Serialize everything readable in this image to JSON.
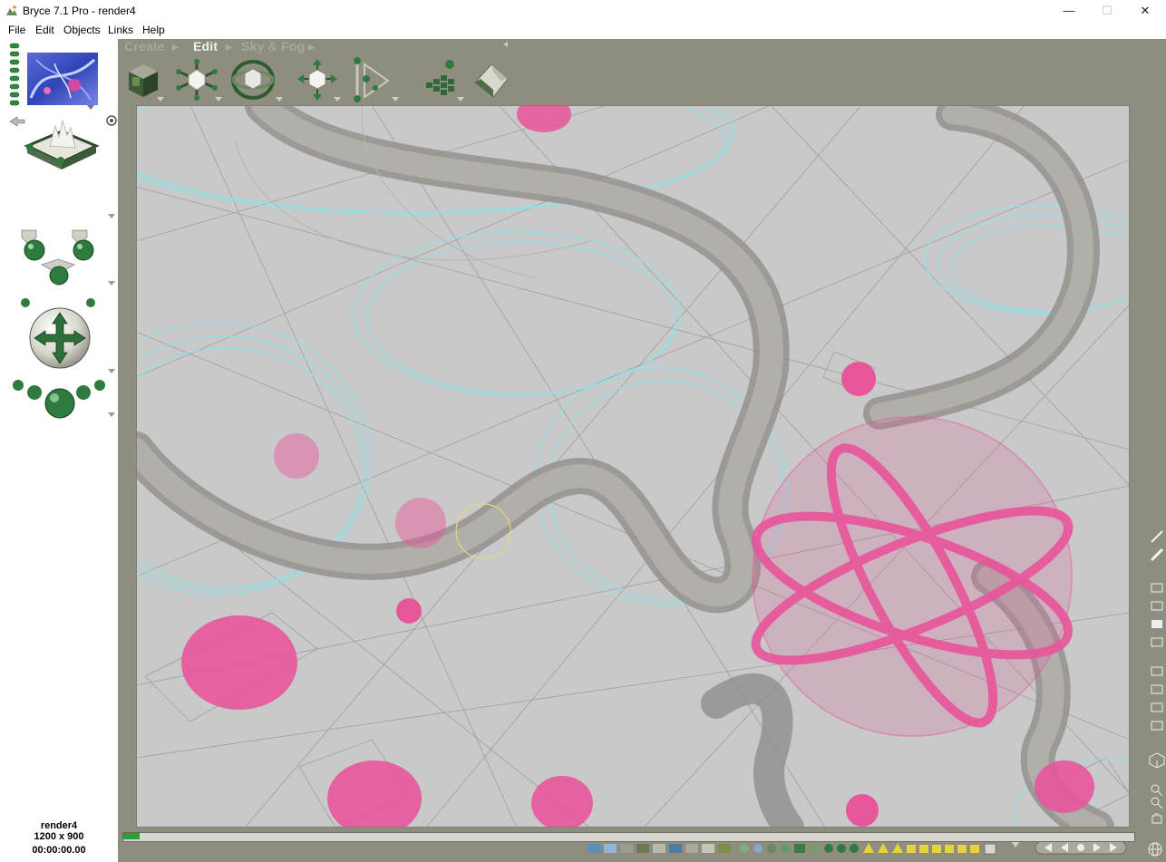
{
  "window": {
    "title": "Bryce 7.1  Pro - render4",
    "min": "—",
    "max": "☐",
    "close": "✕"
  },
  "menu": [
    "File",
    "Edit",
    "Objects",
    "Links",
    "Help"
  ],
  "palette_tabs": [
    "Create",
    "Edit",
    "Sky & Fog"
  ],
  "palette_tab_arrow": "▸",
  "active_tab": "Edit",
  "edit_tools": [
    "material-lab",
    "resize",
    "rotate",
    "reposition",
    "align",
    "randomize",
    "terrain-editor"
  ],
  "status": {
    "document": "render4",
    "resolution": "1200 x 900",
    "time": "00:00:00.00"
  },
  "colors": {
    "workspace": "#8e8d80",
    "viewport": "#c9c9c9",
    "selection": "#e8559a",
    "wire_cyan": "#8fe3e8",
    "wire_gray": "#8f8a84"
  }
}
